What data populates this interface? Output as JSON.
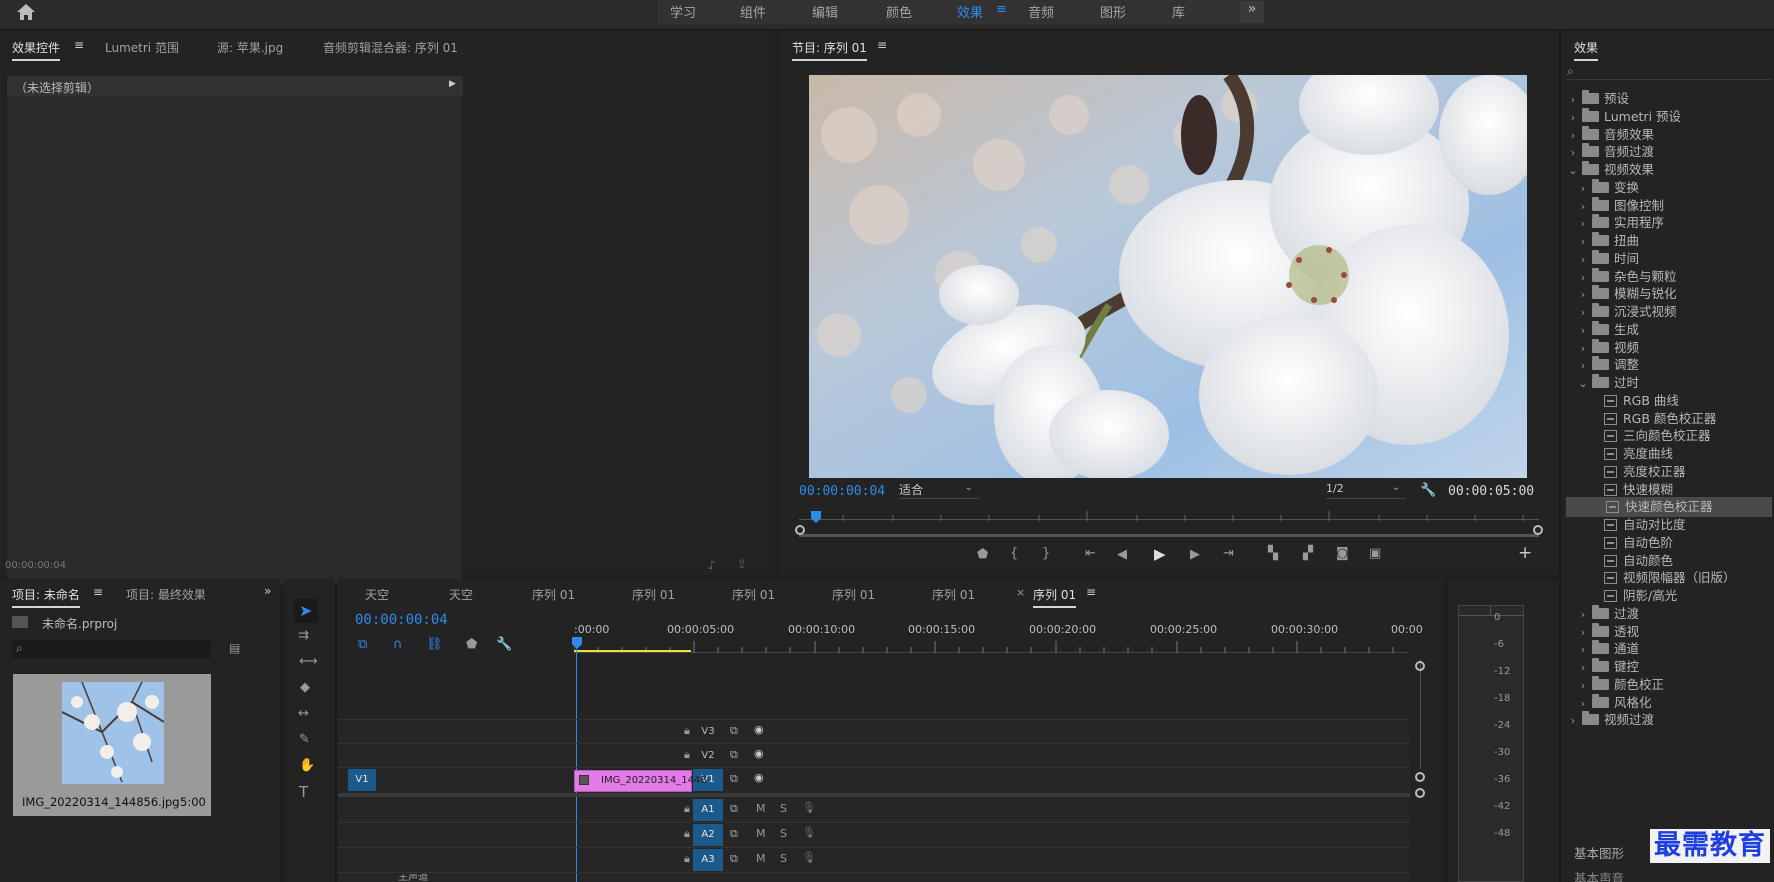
{
  "topbar": {
    "workspaces": [
      "学习",
      "组件",
      "编辑",
      "颜色",
      "效果",
      "音频",
      "图形",
      "库"
    ],
    "active_workspace": "效果"
  },
  "left_panel": {
    "tabs": [
      "效果控件",
      "Lumetri 范围",
      "源: 苹果.jpg",
      "音频剪辑混合器: 序列 01"
    ],
    "no_clip": "（未选择剪辑）",
    "timecode": "00:00:00:04"
  },
  "program": {
    "title": "节目: 序列 01",
    "timecode": "00:00:00:04",
    "fit": "适合",
    "resolution": "1/2",
    "duration": "00:00:05:00"
  },
  "project": {
    "tabs": [
      "项目: 未命名",
      "项目: 最终效果"
    ],
    "file": "未命名.prproj",
    "clip_name": "IMG_20220314_144856.jpg",
    "clip_duration": "5:00"
  },
  "timeline": {
    "tabs": [
      "天空",
      "天空",
      "序列 01",
      "序列 01",
      "序列 01",
      "序列 01",
      "序列 01",
      "序列 01"
    ],
    "timecode": "00:00:00:04",
    "ruler": [
      ":00:00",
      "00:00:05:00",
      "00:00:10:00",
      "00:00:15:00",
      "00:00:20:00",
      "00:00:25:00",
      "00:00:30:00",
      "00:00"
    ],
    "video_tracks": [
      "V3",
      "V2",
      "V1"
    ],
    "audio_tracks": [
      "A1",
      "A2",
      "A3"
    ],
    "source_patch": "V1",
    "clip_label": "IMG_20220314_1448",
    "master_label": "主声道",
    "m_label": "M",
    "s_label": "S"
  },
  "meter": {
    "scale": [
      "0",
      "-6",
      "-12",
      "-18",
      "-24",
      "-30",
      "-36",
      "-42",
      "-48"
    ]
  },
  "effects": {
    "title": "效果",
    "items": [
      {
        "label": "预设",
        "level": 0,
        "type": "folder",
        "open": false
      },
      {
        "label": "Lumetri 预设",
        "level": 0,
        "type": "folder",
        "open": false
      },
      {
        "label": "音频效果",
        "level": 0,
        "type": "folder",
        "open": false
      },
      {
        "label": "音频过渡",
        "level": 0,
        "type": "folder",
        "open": false
      },
      {
        "label": "视频效果",
        "level": 0,
        "type": "folder",
        "open": true
      },
      {
        "label": "变换",
        "level": 1,
        "type": "folder",
        "open": false
      },
      {
        "label": "图像控制",
        "level": 1,
        "type": "folder",
        "open": false
      },
      {
        "label": "实用程序",
        "level": 1,
        "type": "folder",
        "open": false
      },
      {
        "label": "扭曲",
        "level": 1,
        "type": "folder",
        "open": false
      },
      {
        "label": "时间",
        "level": 1,
        "type": "folder",
        "open": false
      },
      {
        "label": "杂色与颗粒",
        "level": 1,
        "type": "folder",
        "open": false
      },
      {
        "label": "模糊与锐化",
        "level": 1,
        "type": "folder",
        "open": false
      },
      {
        "label": "沉浸式视频",
        "level": 1,
        "type": "folder",
        "open": false
      },
      {
        "label": "生成",
        "level": 1,
        "type": "folder",
        "open": false
      },
      {
        "label": "视频",
        "level": 1,
        "type": "folder",
        "open": false
      },
      {
        "label": "调整",
        "level": 1,
        "type": "folder",
        "open": false
      },
      {
        "label": "过时",
        "level": 1,
        "type": "folder",
        "open": true
      },
      {
        "label": "RGB 曲线",
        "level": 2,
        "type": "effect"
      },
      {
        "label": "RGB 颜色校正器",
        "level": 2,
        "type": "effect"
      },
      {
        "label": "三向颜色校正器",
        "level": 2,
        "type": "effect"
      },
      {
        "label": "亮度曲线",
        "level": 2,
        "type": "effect"
      },
      {
        "label": "亮度校正器",
        "level": 2,
        "type": "effect"
      },
      {
        "label": "快速模糊",
        "level": 2,
        "type": "effect"
      },
      {
        "label": "快速颜色校正器",
        "level": 2,
        "type": "effect",
        "selected": true
      },
      {
        "label": "自动对比度",
        "level": 2,
        "type": "effect"
      },
      {
        "label": "自动色阶",
        "level": 2,
        "type": "effect"
      },
      {
        "label": "自动颜色",
        "level": 2,
        "type": "effect"
      },
      {
        "label": "视频限幅器（旧版）",
        "level": 2,
        "type": "effect"
      },
      {
        "label": "阴影/高光",
        "level": 2,
        "type": "effect"
      },
      {
        "label": "过渡",
        "level": 1,
        "type": "folder",
        "open": false
      },
      {
        "label": "透视",
        "level": 1,
        "type": "folder",
        "open": false
      },
      {
        "label": "通道",
        "level": 1,
        "type": "folder",
        "open": false
      },
      {
        "label": "键控",
        "level": 1,
        "type": "folder",
        "open": false
      },
      {
        "label": "颜色校正",
        "level": 1,
        "type": "folder",
        "open": false
      },
      {
        "label": "风格化",
        "level": 1,
        "type": "folder",
        "open": false
      },
      {
        "label": "视频过渡",
        "level": 0,
        "type": "folder",
        "open": false
      }
    ],
    "bottom_items": [
      "基本图形",
      "基本声音"
    ]
  },
  "watermark": "最需教育",
  "colors": {
    "accent": "#2d8ceb",
    "clip": "#e27be6",
    "track_on": "#1d5a8c",
    "playhead": "#2d8ceb"
  }
}
